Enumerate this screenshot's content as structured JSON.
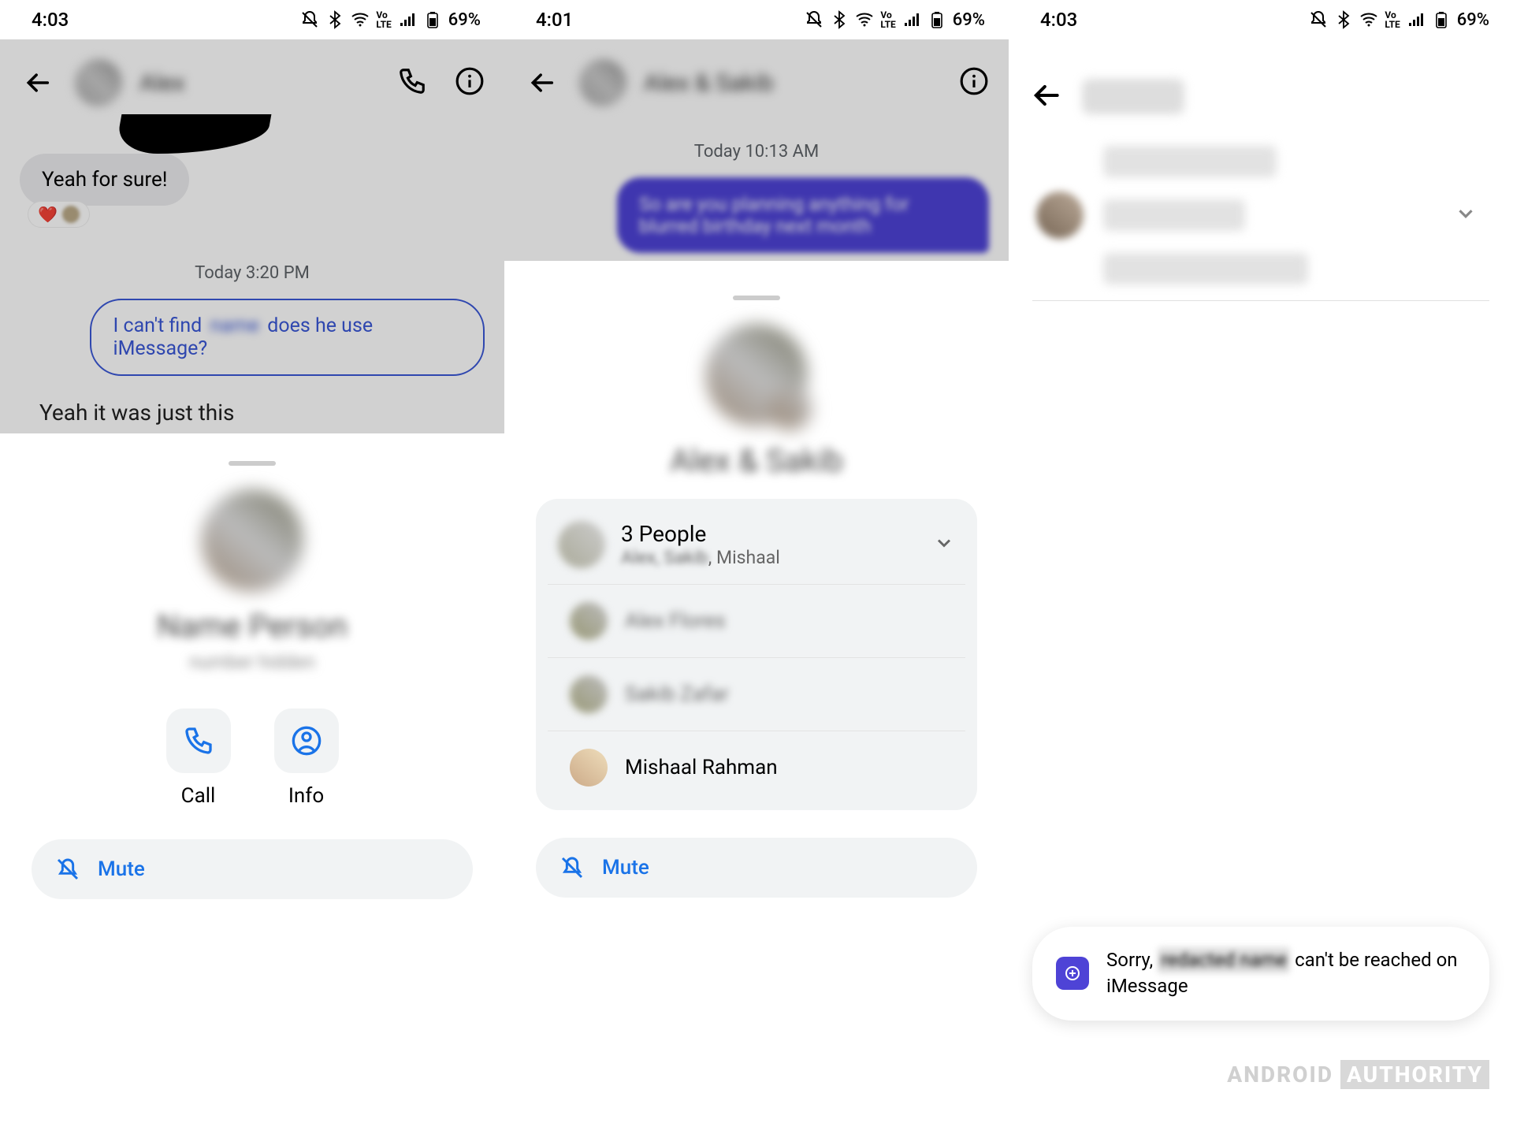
{
  "status": {
    "time_1": "4:03",
    "time_2": "4:01",
    "time_3": "4:03",
    "battery": "69%"
  },
  "screen1": {
    "contact_name": "Alex",
    "msg_in": "Yeah for sure!",
    "reaction_emoji": "❤️",
    "timestamp": "Today  3:20 PM",
    "msg_out_pre": "I can't find ",
    "msg_out_blur": "name",
    "msg_out_post": " does he use iMessage?",
    "cutoff": "Yeah it was just this",
    "sheet": {
      "name_blur": "Name Person",
      "sub_blur": "number hidden",
      "call": "Call",
      "info": "Info",
      "mute": "Mute"
    }
  },
  "screen2": {
    "title_blur": "Alex & Sakib",
    "timestamp": "Today  10:13 AM",
    "sheet_name": "Alex & Sakib",
    "people": {
      "title": "3 People",
      "sub_blur": "Alex, Sakib",
      "sub_suffix": ", Mishaal",
      "p1": "Alex Flores",
      "p2": "Sakib Zafar",
      "p3": "Mishaal Rahman"
    },
    "mute": "Mute"
  },
  "screen3": {
    "toast_pre": "Sorry, ",
    "toast_blur": "redacted name",
    "toast_post": " can't be reached on iMessage"
  },
  "watermark": {
    "a": "ANDROID",
    "b": "AUTHORITY"
  }
}
